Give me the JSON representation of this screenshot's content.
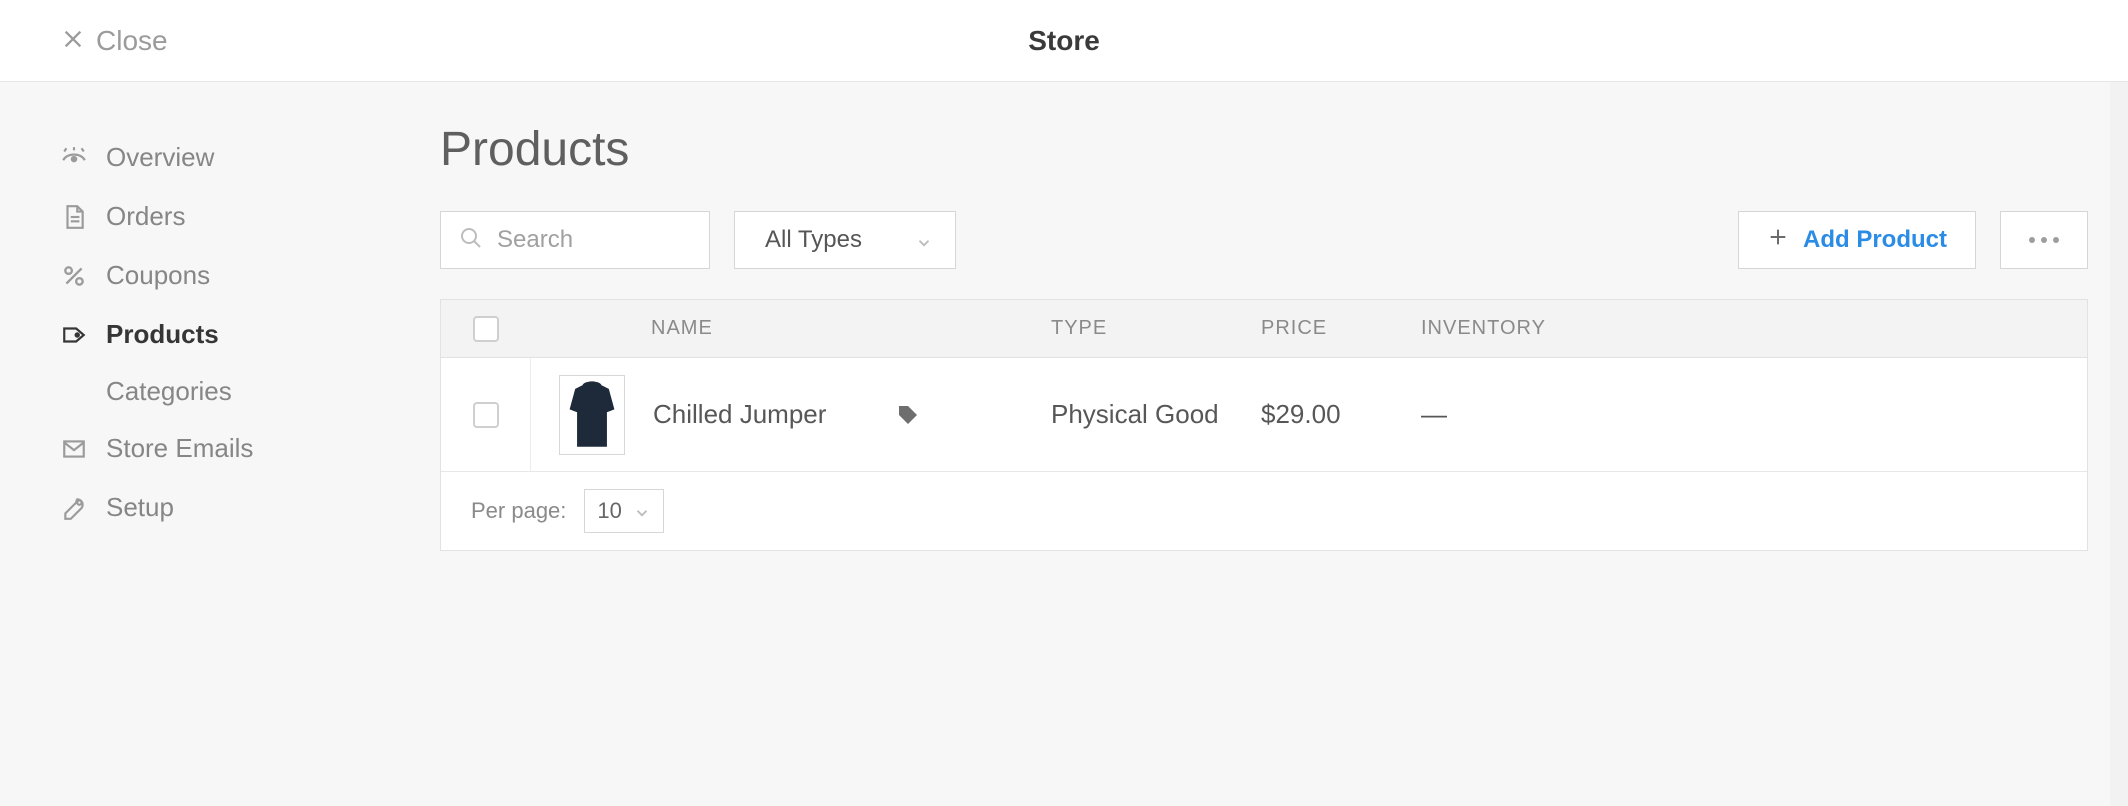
{
  "header": {
    "close_label": "Close",
    "title": "Store"
  },
  "sidebar": {
    "items": [
      {
        "id": "overview",
        "label": "Overview",
        "icon": "eye-icon"
      },
      {
        "id": "orders",
        "label": "Orders",
        "icon": "document-icon"
      },
      {
        "id": "coupons",
        "label": "Coupons",
        "icon": "percent-icon"
      },
      {
        "id": "products",
        "label": "Products",
        "icon": "tag-icon",
        "active": true,
        "subitems": [
          {
            "id": "categories",
            "label": "Categories"
          }
        ]
      },
      {
        "id": "store-emails",
        "label": "Store Emails",
        "icon": "mail-icon"
      },
      {
        "id": "setup",
        "label": "Setup",
        "icon": "wrench-icon"
      }
    ]
  },
  "page": {
    "title": "Products"
  },
  "toolbar": {
    "search_placeholder": "Search",
    "type_filter": {
      "selected": "All Types"
    },
    "add_label": "Add Product"
  },
  "table": {
    "columns": {
      "name": "NAME",
      "type": "TYPE",
      "price": "PRICE",
      "inventory": "INVENTORY"
    },
    "rows": [
      {
        "name": "Chilled Jumper",
        "type": "Physical Good",
        "price": "$29.00",
        "inventory": "—",
        "tagged": true
      }
    ],
    "footer": {
      "per_page_label": "Per page:",
      "per_page_value": "10"
    }
  },
  "colors": {
    "accent": "#2b8ce6",
    "muted": "#8a8a8a",
    "border": "#e2e2e2"
  }
}
